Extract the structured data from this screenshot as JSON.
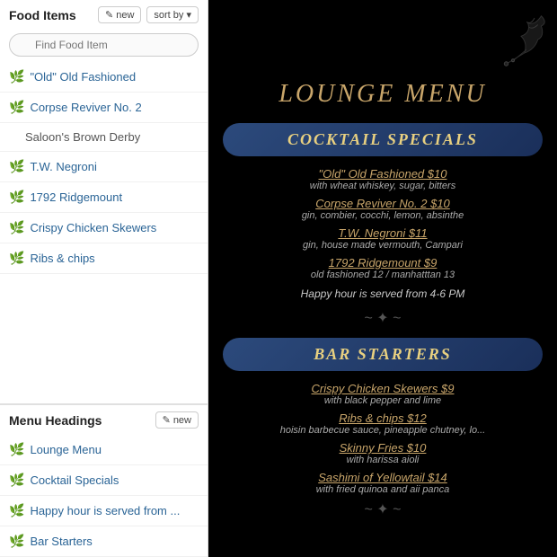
{
  "left": {
    "food_items_title": "Food Items",
    "new_label": "new",
    "sort_label": "sort by",
    "search_placeholder": "Find Food Item",
    "food_items": [
      {
        "id": "old-fashioned",
        "label": "\"Old\" Old Fashioned",
        "has_icon": true
      },
      {
        "id": "corpse-reviver",
        "label": "Corpse Reviver No. 2",
        "has_icon": true
      },
      {
        "id": "saloons-brown-derby",
        "label": "Saloon's Brown Derby",
        "has_icon": false,
        "sub": true
      },
      {
        "id": "tw-negroni",
        "label": "T.W. Negroni",
        "has_icon": true
      },
      {
        "id": "1792-ridgemount",
        "label": "1792 Ridgemount",
        "has_icon": true
      },
      {
        "id": "crispy-chicken",
        "label": "Crispy Chicken Skewers",
        "has_icon": true
      },
      {
        "id": "ribs-chips",
        "label": "Ribs & chips",
        "has_icon": true
      }
    ],
    "menu_headings_title": "Menu Headings",
    "menu_headings": [
      {
        "id": "lounge-menu",
        "label": "Lounge Menu"
      },
      {
        "id": "cocktail-specials",
        "label": "Cocktail Specials"
      },
      {
        "id": "happy-hour",
        "label": "Happy hour is served from ..."
      },
      {
        "id": "bar-starters",
        "label": "Bar Starters"
      }
    ]
  },
  "right": {
    "menu_title": "LOUNGE MENU",
    "sections": [
      {
        "heading": "COCKTAIL SPECIALS",
        "items": [
          {
            "name": "\"Old\" Old Fashioned",
            "price": "$10",
            "desc": "with wheat whiskey, sugar, bitters"
          },
          {
            "name": "Corpse Reviver No. 2",
            "price": "$10",
            "desc": "gin, combier, cocchi, lemon, absinthe"
          },
          {
            "name": "T.W. Negroni",
            "price": "$11",
            "desc": "gin, house made vermouth, Campari"
          },
          {
            "name": "1792 Ridgemount",
            "price": "$9",
            "desc": "old fashioned 12 / manhatttan 13"
          }
        ],
        "footer": "Happy hour is served from 4-6 PM"
      },
      {
        "heading": "BAR STARTERS",
        "items": [
          {
            "name": "Crispy Chicken Skewers",
            "price": "$9",
            "desc": "with black pepper and lime"
          },
          {
            "name": "Ribs & chips",
            "price": "$12",
            "desc": "hoisin barbecue sauce, pineapple chutney, lo..."
          },
          {
            "name": "Skinny Fries",
            "price": "$10",
            "desc": "with harissa aioli"
          },
          {
            "name": "Sashimi of Yellowtail",
            "price": "$14",
            "desc": "with fried quinoa and aii panca"
          }
        ]
      }
    ]
  },
  "icons": {
    "edit": "✎",
    "chevron_down": "▾",
    "leaf": "🌿",
    "search": "🔍"
  }
}
